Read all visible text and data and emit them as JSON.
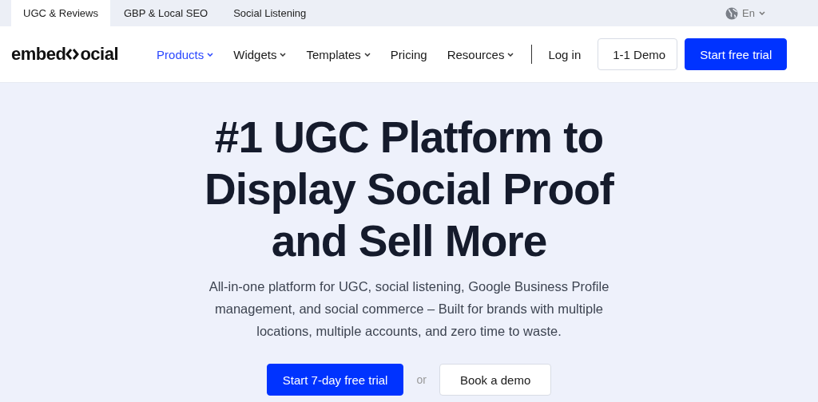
{
  "top_tabs": [
    {
      "label": "UGC & Reviews",
      "selected": true
    },
    {
      "label": "GBP & Local SEO",
      "selected": false
    },
    {
      "label": "Social Listening",
      "selected": false
    }
  ],
  "language": {
    "label": "En"
  },
  "logo": {
    "before": "embed",
    "after": "ocial"
  },
  "nav": [
    {
      "label": "Products",
      "has_menu": true,
      "selected": true
    },
    {
      "label": "Widgets",
      "has_menu": true,
      "selected": false
    },
    {
      "label": "Templates",
      "has_menu": true,
      "selected": false
    },
    {
      "label": "Pricing",
      "has_menu": false,
      "selected": false
    },
    {
      "label": "Resources",
      "has_menu": true,
      "selected": false
    }
  ],
  "login": "Log in",
  "header_buttons": [
    {
      "label": "1-1 Demo",
      "kind": "outline"
    },
    {
      "label": "Start free trial",
      "kind": "primary"
    }
  ],
  "hero": {
    "headline": [
      "#1 UGC Platform to",
      "Display Social Proof",
      "and Sell More"
    ],
    "description": "All-in-one platform for UGC, social listening, Google Business Profile management, and social commerce – Built for brands with multiple locations, multiple accounts, and zero time to waste.",
    "primary_button": "Start 7-day free trial",
    "separator": "or",
    "secondary_button": "Book a demo"
  }
}
